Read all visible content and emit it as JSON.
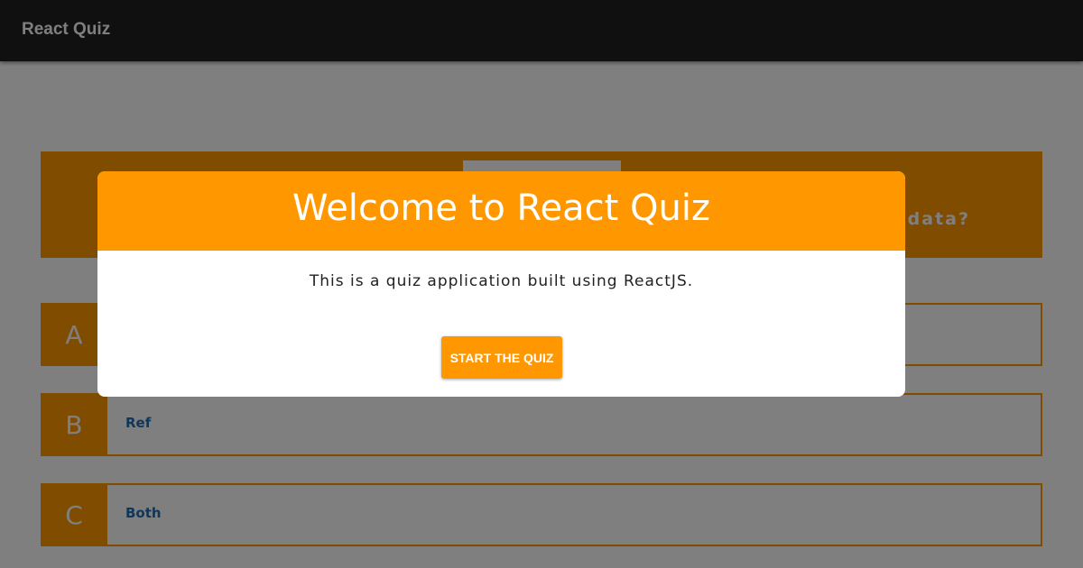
{
  "appbar": {
    "title": "React Quiz"
  },
  "quiz": {
    "question_text_visible": "data?",
    "options": [
      {
        "letter": "A",
        "text": ""
      },
      {
        "letter": "B",
        "text": "Ref"
      },
      {
        "letter": "C",
        "text": "Both"
      }
    ]
  },
  "modal": {
    "title": "Welcome to React Quiz",
    "body": "This is a quiz application built using ReactJS.",
    "start_button_label": "START THE QUIZ"
  },
  "colors": {
    "accent": "#ff9800",
    "appbar": "#212121",
    "option_text": "#1e6fb6",
    "backdrop": "rgba(0,0,0,0.5)"
  }
}
